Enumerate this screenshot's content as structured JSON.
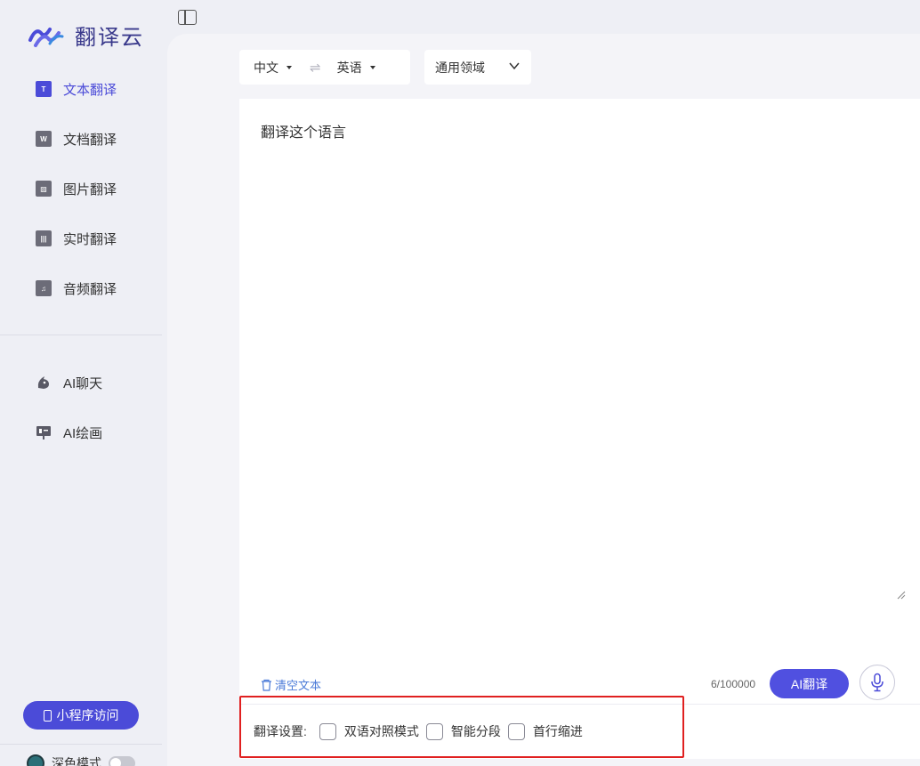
{
  "app": {
    "name": "翻译云"
  },
  "sidebar": {
    "items": [
      {
        "label": "文本翻译",
        "icon": "text-translate-icon",
        "icon_text": "T",
        "active": true
      },
      {
        "label": "文档翻译",
        "icon": "document-translate-icon",
        "icon_text": "W",
        "active": false
      },
      {
        "label": "图片翻译",
        "icon": "image-translate-icon",
        "icon_text": "▨",
        "active": false
      },
      {
        "label": "实时翻译",
        "icon": "voice-translate-icon",
        "icon_text": "|||",
        "active": false
      },
      {
        "label": "音频翻译",
        "icon": "audio-translate-icon",
        "icon_text": "♫",
        "active": false
      }
    ],
    "ai_items": [
      {
        "label": "AI聊天",
        "icon": "ai-chat-icon"
      },
      {
        "label": "AI绘画",
        "icon": "ai-paint-icon"
      }
    ],
    "mini_program_label": "小程序访问",
    "dark_mode_label": "深色模式",
    "dark_mode_on": false
  },
  "translate": {
    "source_lang": "中文",
    "swap_symbol": "⇌",
    "target_lang": "英语",
    "domain": "通用领域",
    "input_text": "翻译这个语言",
    "clear_label": "清空文本",
    "char_count": "6/100000",
    "translate_button": "AI翻译"
  },
  "settings": {
    "label": "翻译设置:",
    "options": [
      {
        "label": "双语对照模式",
        "checked": false
      },
      {
        "label": "智能分段",
        "checked": false
      },
      {
        "label": "首行缩进",
        "checked": false
      }
    ]
  },
  "colors": {
    "accent": "#4b4bd8",
    "button": "#5050e0",
    "highlight_border": "#e02020"
  }
}
